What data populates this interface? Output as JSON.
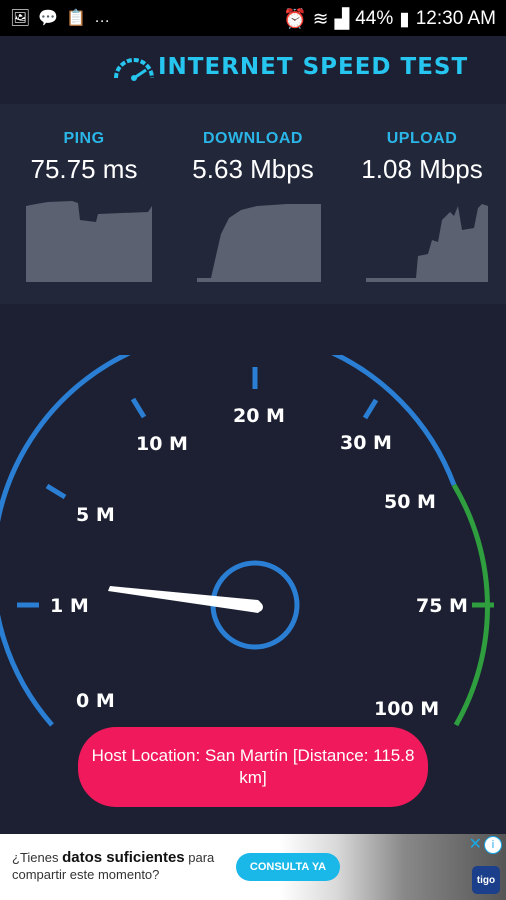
{
  "status_bar": {
    "battery": "44%",
    "time": "12:30 AM",
    "icons": [
      "photo-icon",
      "chat-icon",
      "clipboard-icon",
      "more-icon",
      "alarm-icon",
      "wifi-icon",
      "signal-icon",
      "battery-icon"
    ]
  },
  "header": {
    "title": "INTERNET SPEED TEST"
  },
  "stats": [
    {
      "label": "PING",
      "value": "75.75 ms"
    },
    {
      "label": "DOWNLOAD",
      "value": "5.63 Mbps"
    },
    {
      "label": "UPLOAD",
      "value": "1.08 Mbps"
    }
  ],
  "gauge": {
    "ticks": [
      "0 M",
      "1 M",
      "5 M",
      "10 M",
      "20 M",
      "30 M",
      "50 M",
      "75 M",
      "100 M"
    ],
    "colors": {
      "scale": "#2a7fd4",
      "high": "#2e9e3e",
      "needle": "#ffffff"
    }
  },
  "host": {
    "text": "Host Location: San Martín [Distance: 115.8 km]"
  },
  "ad": {
    "line1_pre": "¿Tienes ",
    "line1_bold": "datos suficientes",
    "line1_post": " para",
    "line2": "compartir este momento?",
    "button": "CONSULTA YA",
    "brand": "tigo"
  }
}
